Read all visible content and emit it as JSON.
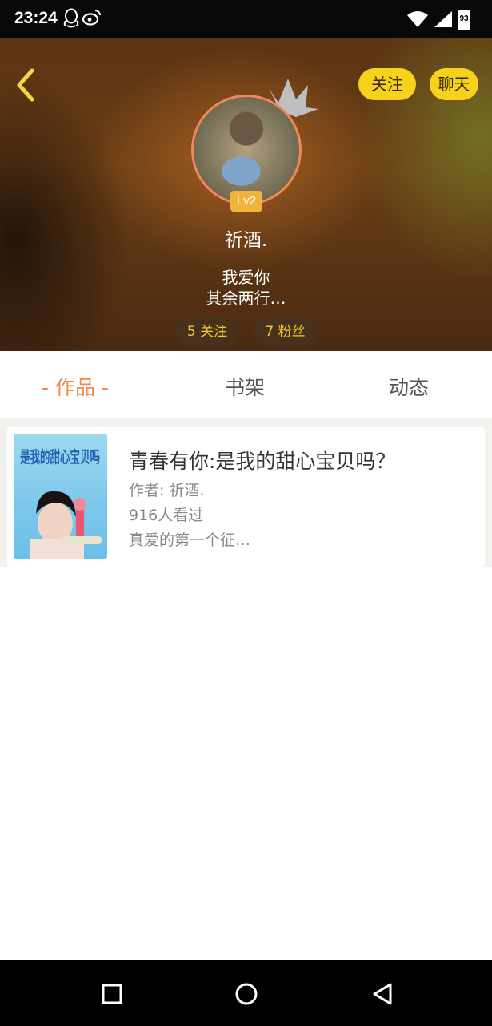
{
  "status_bar": {
    "time": "23:24",
    "battery": "93",
    "icons": [
      "qq-icon",
      "weibo-icon",
      "wifi-icon",
      "signal-icon",
      "battery-icon"
    ]
  },
  "profile": {
    "follow_label": "关注",
    "chat_label": "聊天",
    "level": "Lv2",
    "username": "祈酒.",
    "bio_line1": "我爱你",
    "bio_line2": "其余两行…",
    "following_count": "5 关注",
    "fans_count": "7 粉丝",
    "accent": "#f7d21a"
  },
  "tabs": {
    "works": "- 作品 -",
    "bookshelf": "书架",
    "moments": "动态",
    "active_color": "#f08a4a"
  },
  "works": [
    {
      "title": "青春有你:是我的甜心宝贝吗？",
      "author": "作者: 祈酒.",
      "views": "916人看过",
      "description": "真爱的第一个征…",
      "cover_text": "是我的甜心宝贝吗"
    }
  ]
}
